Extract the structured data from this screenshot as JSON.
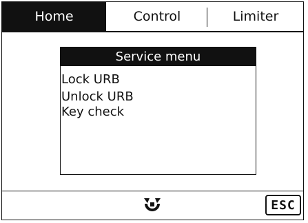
{
  "tabs": [
    {
      "label": "Home",
      "active": true
    },
    {
      "label": "Control",
      "active": false
    },
    {
      "label": "Limiter",
      "active": false
    }
  ],
  "service_menu": {
    "title": "Service menu",
    "items": [
      "Lock URB",
      "Unlock URB",
      "Key check"
    ]
  },
  "bottom_bar": {
    "reset_icon": "rotate-arrows-icon",
    "esc_label": "ESC"
  },
  "colors": {
    "foreground": "#111111",
    "background": "#ffffff"
  }
}
